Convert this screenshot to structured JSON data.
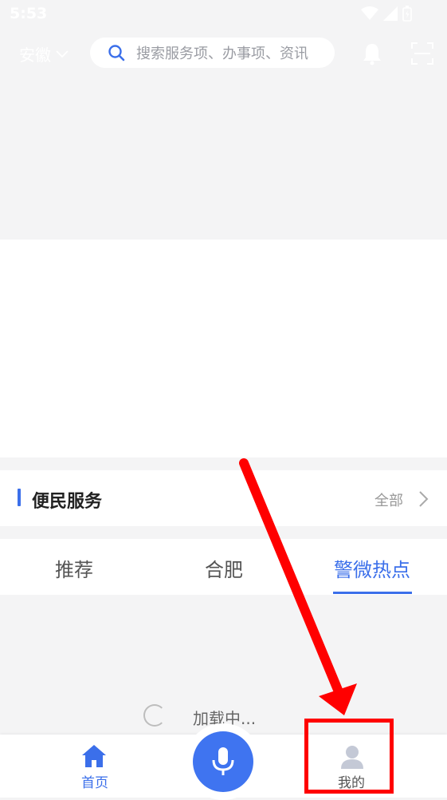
{
  "status_bar": {
    "time": "5:53"
  },
  "header": {
    "region": "安徽",
    "search_placeholder": "搜索服务项、办事项、资讯"
  },
  "section": {
    "title": "便民服务",
    "more_label": "全部"
  },
  "tabs": [
    {
      "label": "推荐",
      "active": false
    },
    {
      "label": "合肥",
      "active": false
    },
    {
      "label": "警微热点",
      "active": true
    }
  ],
  "loading_text": "加载中...",
  "bottom_nav": {
    "home_label": "首页",
    "mine_label": "我的"
  },
  "colors": {
    "accent": "#3b6fea",
    "mic_button": "#3f74f0",
    "annotation": "#ff0000"
  },
  "icons": [
    "search-icon",
    "bell-icon",
    "scan-icon",
    "chevron-right-icon",
    "home-icon",
    "microphone-icon",
    "user-icon"
  ]
}
